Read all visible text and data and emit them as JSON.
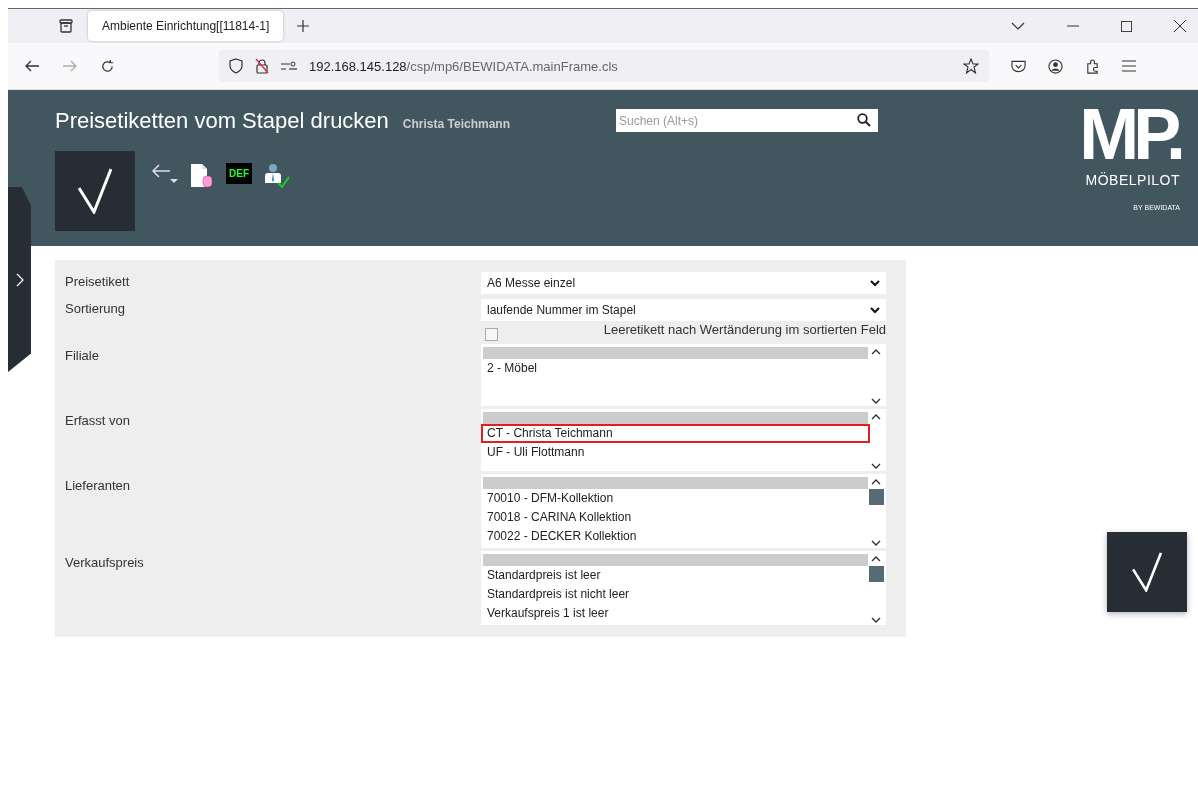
{
  "browser": {
    "tab_title": "Ambiente Einrichtung[[11814-1]",
    "url_host": "192.168.145.128",
    "url_path": "/csp/mp6/BEWIDATA.mainFrame.cls"
  },
  "header": {
    "title": "Preisetiketten vom Stapel drucken",
    "user": "Christa Teichmann",
    "search": {
      "placeholder": "Suchen (Alt+s)"
    },
    "logo": {
      "mark": "MP.",
      "name": "MÖBELPILOT",
      "by": "BY BEWIDATA"
    },
    "def_label": "DEF"
  },
  "form": [
    {
      "kind": "select",
      "label": "Preisetikett",
      "value": "A6 Messe einzel"
    },
    {
      "kind": "select",
      "label": "Sortierung",
      "value": "laufende Nummer im Stapel"
    },
    {
      "kind": "checkbox",
      "label": "Leeretikett nach Wertänderung im sortierten Feld",
      "checked": false
    },
    {
      "kind": "listbox",
      "label": "Filiale",
      "blank_selected": true,
      "items": [
        {
          "text": "2 - Möbel",
          "highlighted": false
        }
      ]
    },
    {
      "kind": "listbox",
      "label": "Erfasst von",
      "blank_selected": true,
      "items": [
        {
          "text": "CT - Christa Teichmann",
          "highlighted": true
        },
        {
          "text": "UF - Uli Flottmann",
          "highlighted": false
        }
      ]
    },
    {
      "kind": "listbox",
      "label": "Lieferanten",
      "blank_selected": true,
      "items": [
        {
          "text": "70010 - DFM-Kollektion",
          "highlighted": false
        },
        {
          "text": "70018 - CARINA Kollektion",
          "highlighted": false
        },
        {
          "text": "70022 - DECKER Kollektion",
          "highlighted": false
        }
      ]
    },
    {
      "kind": "listbox",
      "label": "Verkaufspreis",
      "blank_selected": true,
      "items": [
        {
          "text": "Standardpreis ist leer",
          "highlighted": false
        },
        {
          "text": "Standardpreis ist nicht leer",
          "highlighted": false
        },
        {
          "text": "Verkaufspreis 1 ist leer",
          "highlighted": false
        }
      ]
    }
  ]
}
